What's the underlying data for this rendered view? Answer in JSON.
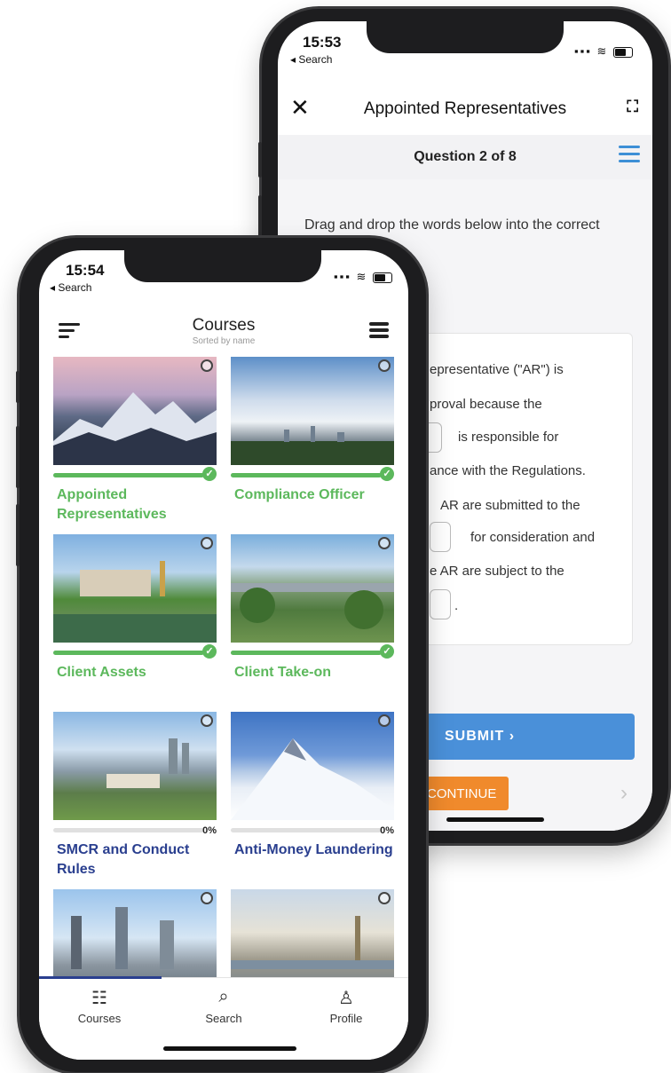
{
  "back_phone": {
    "status": {
      "time": "15:53",
      "back_label": "◂ Search"
    },
    "header": {
      "close_icon": "✕",
      "title": "Appointed Representatives",
      "expand_icon": "⛶"
    },
    "question_bar": {
      "label": "Question 2 of 8"
    },
    "instruction": "Drag and drop the words below into the correct position.",
    "sentence_fragments": [
      "epresentative (\"AR\") is",
      "proval because the",
      "is responsible for",
      "ance with the Regulations.",
      "AR are submitted to the",
      "for consideration and",
      "e AR are subject to the",
      "."
    ],
    "submit_label": "SUBMIT ›",
    "continue_label": "CONTINUE",
    "next_icon": "›"
  },
  "front_phone": {
    "status": {
      "time": "15:54",
      "back_label": "◂ Search"
    },
    "header": {
      "title": "Courses",
      "subtitle": "Sorted by name"
    },
    "courses": [
      {
        "title": "Appointed Representatives",
        "completed": true,
        "progress": 1.0,
        "title_color": "#5cb85c"
      },
      {
        "title": "Compliance Officer",
        "completed": true,
        "progress": 1.0,
        "title_color": "#5cb85c"
      },
      {
        "title": "Client Assets",
        "completed": true,
        "progress": 1.0,
        "title_color": "#5cb85c"
      },
      {
        "title": "Client Take-on",
        "completed": true,
        "progress": 1.0,
        "title_color": "#5cb85c"
      },
      {
        "title": "SMCR and Conduct Rules",
        "completed": false,
        "progress": 0,
        "percent": "0%",
        "title_color": "#2a3f8f"
      },
      {
        "title": "Anti-Money Laundering",
        "completed": false,
        "progress": 0,
        "percent": "0%",
        "title_color": "#2a3f8f"
      },
      {
        "title": "",
        "completed": false,
        "progress": 0
      },
      {
        "title": "",
        "completed": false,
        "progress": 0
      }
    ],
    "tabs": [
      {
        "label": "Courses",
        "icon": "courses-icon"
      },
      {
        "label": "Search",
        "icon": "search-icon"
      },
      {
        "label": "Profile",
        "icon": "profile-icon"
      }
    ]
  },
  "colors": {
    "accent_green": "#5cb85c",
    "accent_navy": "#2a3f8f",
    "submit_blue": "#4a90d9",
    "continue_orange": "#f08a2c"
  }
}
